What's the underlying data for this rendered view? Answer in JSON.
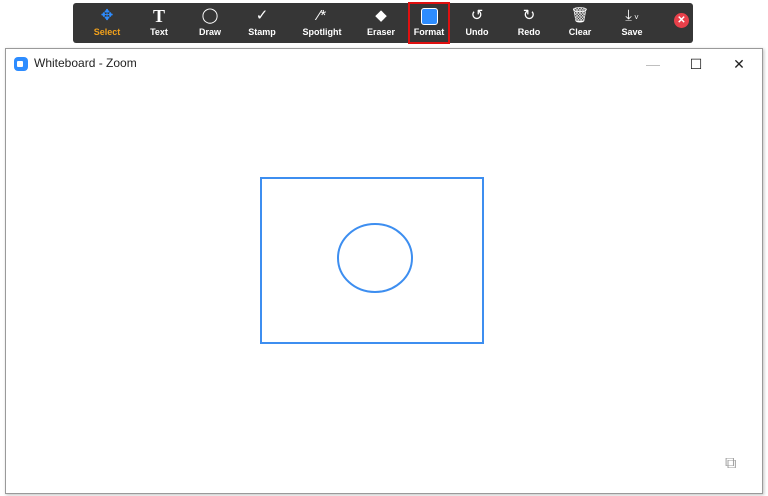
{
  "toolbar": {
    "tools": [
      {
        "label": "Select",
        "icon": "move-icon"
      },
      {
        "label": "Text",
        "icon": "text-icon"
      },
      {
        "label": "Draw",
        "icon": "ellipse-icon"
      },
      {
        "label": "Stamp",
        "icon": "check-icon"
      },
      {
        "label": "Spotlight",
        "icon": "wand-icon"
      },
      {
        "label": "Eraser",
        "icon": "eraser-icon"
      },
      {
        "label": "Format",
        "icon": "color-swatch-icon"
      },
      {
        "label": "Undo",
        "icon": "undo-icon"
      },
      {
        "label": "Redo",
        "icon": "redo-icon"
      },
      {
        "label": "Clear",
        "icon": "trash-icon"
      },
      {
        "label": "Save",
        "icon": "download-icon"
      }
    ],
    "selected": "Select",
    "highlighted": "Format"
  },
  "window": {
    "title": "Whiteboard - Zoom"
  },
  "colors": {
    "accent": "#2d8cff",
    "shape": "#3d8ef0",
    "highlight": "#e01010",
    "select": "#f2a11b"
  }
}
